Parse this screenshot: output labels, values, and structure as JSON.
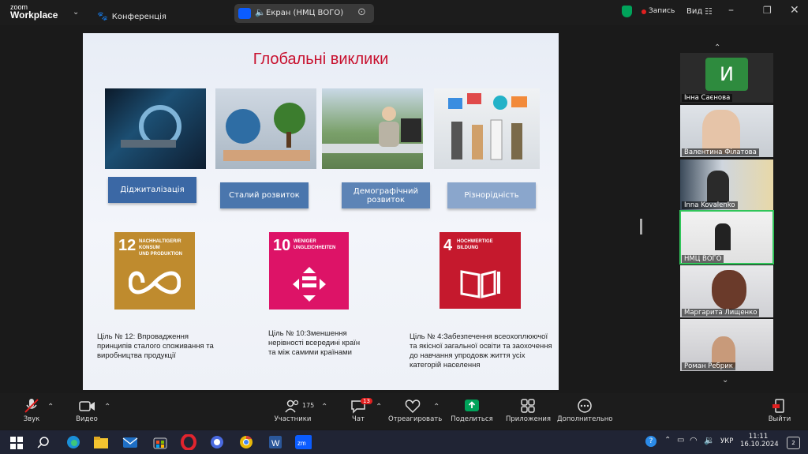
{
  "titlebar": {
    "app_line1": "zoom",
    "app_line2": "Workplace",
    "conference": "Конференція",
    "share_label": "Екран (НМЦ ВОГО)",
    "record": "Запись",
    "view": "Вид"
  },
  "slide": {
    "title": "Глобальні виклики",
    "ribbons": [
      "Діджиталізація",
      "Сталий розвиток",
      "Демографічний розвиток",
      "Різнорідність"
    ],
    "sdg": [
      {
        "num": "12",
        "label": "NACHHALTIGER/R\nKONSUM\nUND PRODUKTION",
        "color": "#BF8B2E"
      },
      {
        "num": "10",
        "label": "WENIGER\nUNGLEICHHEITEN",
        "color": "#DD1367"
      },
      {
        "num": "4",
        "label": "HOCHWERTIGE\nBILDUNG",
        "color": "#C5192D"
      }
    ],
    "goals": [
      "Ціль № 12: Впровадження принципів сталого споживання та виробництва продукції",
      "Ціль № 10:Зменшення нерівності всередині країн та між самими країнами",
      "Ціль № 4:Забезпечення всеохоплюючої та якісної загальної освіти та заохочення до навчання упродовж життя усіх категорій населення"
    ]
  },
  "participants": [
    {
      "name": "Інна Саєнова",
      "initial": "И"
    },
    {
      "name": "Валентина Філатова"
    },
    {
      "name": "Inna Kovalenko"
    },
    {
      "name": "НМЦ ВОГО"
    },
    {
      "name": "Маргарита Лищенко"
    },
    {
      "name": "Роман Ребрик"
    }
  ],
  "toolbar": {
    "audio": "Звук",
    "video": "Видео",
    "participants": "Участники",
    "participants_count": "175",
    "chat": "Чат",
    "chat_badge": "13",
    "react": "Отреагировать",
    "share": "Поделиться",
    "apps": "Приложения",
    "more": "Дополнительно",
    "leave": "Выйти"
  },
  "taskbar": {
    "lang": "УКР",
    "time": "11:11",
    "date": "16.10.2024",
    "notif": "2"
  },
  "colors": {
    "accent_green": "#00A35A",
    "record_red": "#E02020",
    "zoom_blue": "#0B5CFF"
  }
}
